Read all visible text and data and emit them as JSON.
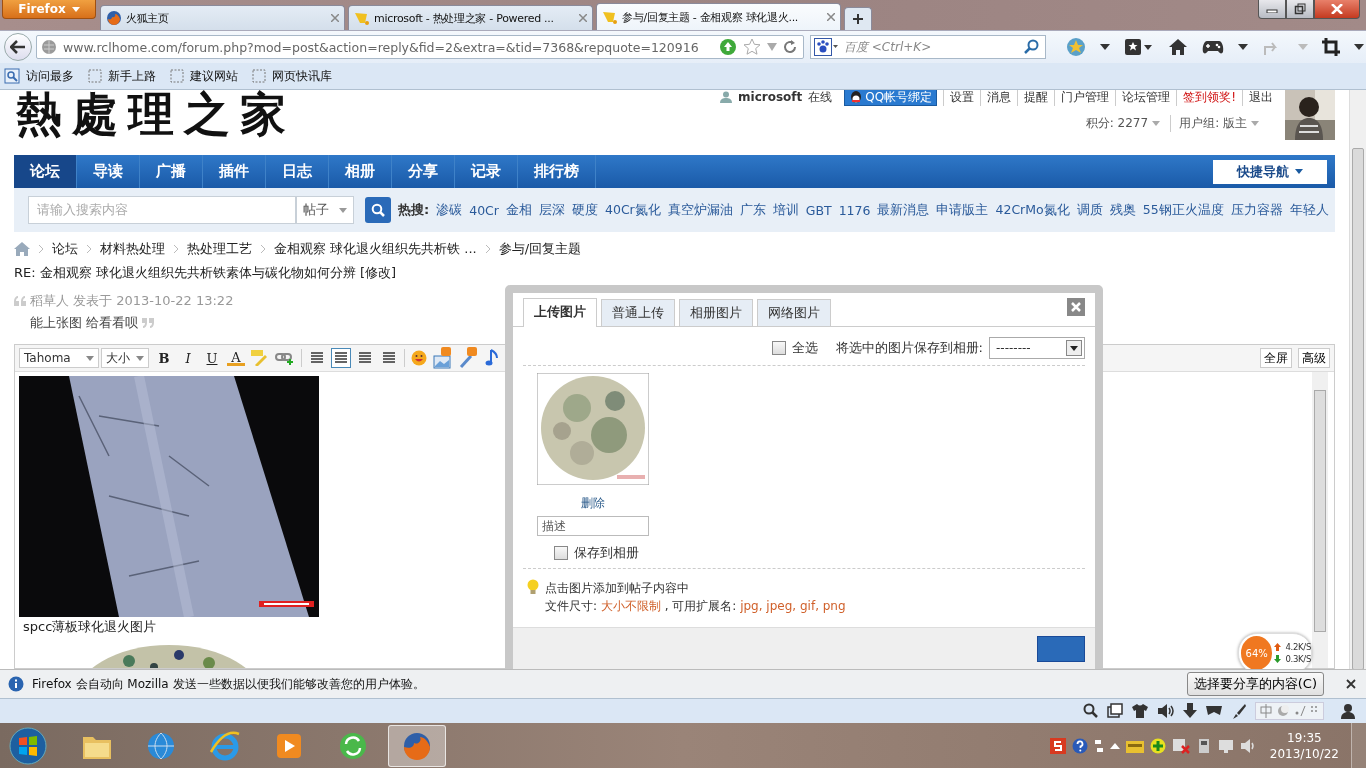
{
  "browser": {
    "menu_button": "Firefox",
    "tabs": [
      {
        "title": "火狐主页",
        "selected": false,
        "kind": "firefox"
      },
      {
        "title": "microsoft - 热处理之家 - Powered ...",
        "selected": false,
        "kind": "forum"
      },
      {
        "title": "参与/回复主题 - 金相观察 球化退火...",
        "selected": true,
        "kind": "forum"
      }
    ],
    "url": "www.rclhome.com/forum.php?mod=post&action=reply&fid=2&extra=&tid=7368&repquote=120916",
    "search_placeholder": "百度 <Ctrl+K>",
    "bookmarks": [
      "访问最多",
      "新手上路",
      "建议网站",
      "网页快讯库"
    ]
  },
  "header": {
    "logo": "熱處理之家",
    "user": "microsoft",
    "status": "在线",
    "qq_bind": "QQ帐号绑定",
    "links": [
      {
        "label": "设置",
        "kind": "normal"
      },
      {
        "label": "消息",
        "kind": "normal"
      },
      {
        "label": "提醒",
        "kind": "normal"
      },
      {
        "label": "门户管理",
        "kind": "normal"
      },
      {
        "label": "论坛管理",
        "kind": "normal"
      },
      {
        "label": "签到领奖!",
        "kind": "highlight"
      },
      {
        "label": "退出",
        "kind": "normal"
      }
    ],
    "credits": "积分: 2277",
    "group": "用户组: 版主"
  },
  "nav": {
    "items": [
      {
        "label": "论坛",
        "selected": true
      },
      {
        "label": "导读",
        "selected": false
      },
      {
        "label": "广播",
        "selected": false
      },
      {
        "label": "插件",
        "selected": false
      },
      {
        "label": "日志",
        "selected": false
      },
      {
        "label": "相册",
        "selected": false
      },
      {
        "label": "分享",
        "selected": false
      },
      {
        "label": "记录",
        "selected": false
      },
      {
        "label": "排行榜",
        "selected": false
      }
    ],
    "quick_nav": "快捷导航"
  },
  "search": {
    "placeholder": "请输入搜索内容",
    "scope": "帖子",
    "hot_label": "热搜:",
    "hot_terms": [
      "渗碳",
      "40Cr",
      "金相",
      "层深",
      "硬度",
      "40Cr氮化",
      "真空炉漏油",
      "广东",
      "培训",
      "GBT",
      "1176",
      "最新消息",
      "申请版主",
      "42CrMo氮化",
      "调质",
      "残奥",
      "55钢正火温度",
      "压力容器",
      "年轻人"
    ]
  },
  "breadcrumb": [
    "论坛",
    "材料热处理",
    "热处理工艺",
    "金相观察 球化退火组织先共析铁 ...",
    "参与/回复主题"
  ],
  "post_title": "RE: 金相观察 球化退火组织先共析铁素体与碳化物如何分辨 [修改]",
  "quote": {
    "author_line": "稻草人 发表于 2013-10-22 13:22",
    "text": "能上张图 给看看呗"
  },
  "editor": {
    "font": "Tahoma",
    "size": "大小",
    "format_buttons": [
      "B",
      "I",
      "U",
      "A"
    ],
    "right_buttons": [
      "全屏",
      "高级"
    ],
    "caption": "spcc薄板球化退火图片"
  },
  "upload_dialog": {
    "tabs": [
      {
        "label": "上传图片",
        "selected": true
      },
      {
        "label": "普通上传",
        "selected": false
      },
      {
        "label": "相册图片",
        "selected": false
      },
      {
        "label": "网络图片",
        "selected": false
      }
    ],
    "select_all": {
      "label": "全选",
      "checked": false
    },
    "save_label": "将选中的图片保存到相册:",
    "album": "--------",
    "delete": "删除",
    "description_placeholder": "描述",
    "save_to_album": {
      "label": "保存到相册",
      "checked": false
    },
    "tip": "点击图片添加到帖子内容中",
    "file_info": [
      {
        "text": "文件尺寸: ",
        "kind": "label"
      },
      {
        "text": "大小不限制",
        "kind": "value"
      },
      {
        "text": " , 可用扩展名: ",
        "kind": "label"
      },
      {
        "text": "jpg, jpeg, gif, png",
        "kind": "value"
      }
    ]
  },
  "net_meter": {
    "percent": "64%",
    "up": "4.2K/S",
    "down": "0.3K/S"
  },
  "notification": {
    "text": "Firefox 会自动向 Mozilla 发送一些数据以便我们能够改善您的用户体验。",
    "button": "选择要分享的内容(C)"
  },
  "taskbar": {
    "apps": [
      {
        "kind": "folder",
        "selected": false
      },
      {
        "kind": "globe",
        "selected": false
      },
      {
        "kind": "ie",
        "selected": false
      },
      {
        "kind": "media",
        "selected": false
      },
      {
        "kind": "refresh",
        "selected": false
      },
      {
        "kind": "firefox",
        "selected": true
      }
    ],
    "time": "19:35",
    "date": "2013/10/22"
  }
}
